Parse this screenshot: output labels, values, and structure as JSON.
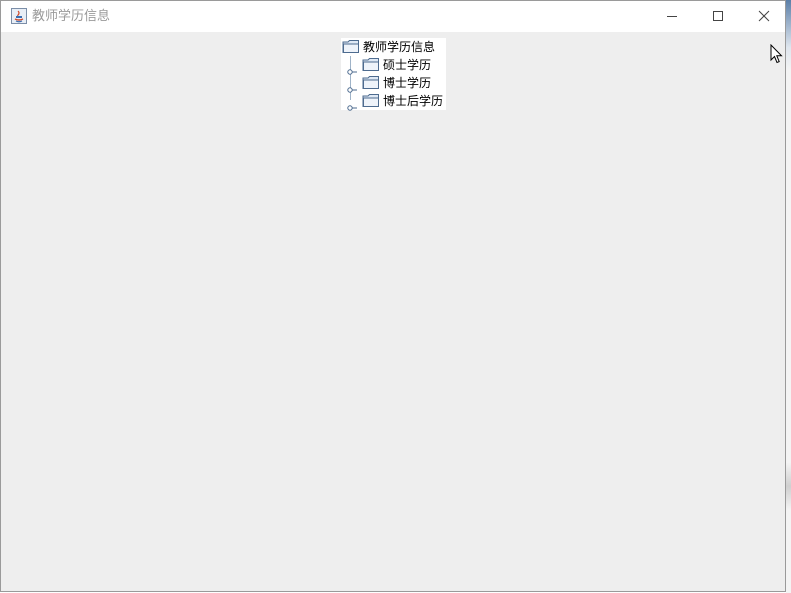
{
  "window": {
    "title": "教师学历信息",
    "icon": "java-app-icon",
    "controls": [
      "minimize-icon",
      "maximize-icon",
      "close-icon"
    ]
  },
  "tree": {
    "root": {
      "label": "教师学历信息",
      "icon": "folder-icon"
    },
    "children": [
      {
        "label": "硕士学历",
        "icon": "folder-icon",
        "expanded": false
      },
      {
        "label": "博士学历",
        "icon": "folder-icon",
        "expanded": false
      },
      {
        "label": "博士后学历",
        "icon": "folder-icon",
        "expanded": false
      }
    ]
  },
  "colors": {
    "window_background": "#eeeeee",
    "titlebar": "#ffffff",
    "title_text": "#9a9a9a",
    "tree_background": "#ffffff",
    "tree_line": "#9fb3c8"
  }
}
